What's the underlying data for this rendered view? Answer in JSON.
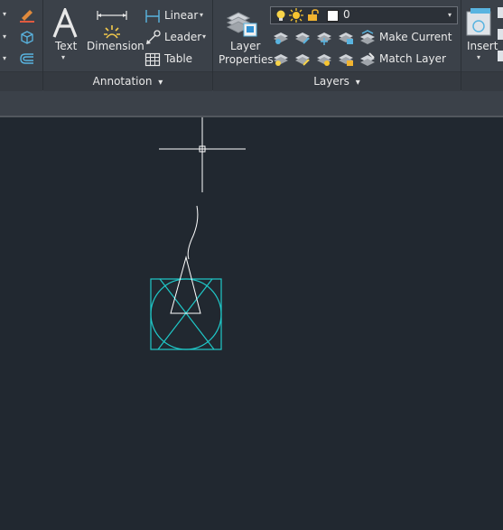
{
  "ribbon": {
    "annotation": {
      "text_label": "Text",
      "dimension_label": "Dimension",
      "linear_label": "Linear",
      "leader_label": "Leader",
      "table_label": "Table",
      "panel_title": "Annotation",
      "dropdown_arrow": "▾"
    },
    "layers": {
      "layer_properties_line1": "Layer",
      "layer_properties_line2": "Properties",
      "current_layer": "0",
      "make_current_label": "Make Current",
      "match_layer_label": "Match Layer",
      "panel_title": "Layers",
      "dropdown_arrow": "▾"
    },
    "insert": {
      "insert_label": "Insert"
    }
  },
  "colors": {
    "canvas": "#212830",
    "ribbon": "#3b4149",
    "geometry": "#1fc8c8",
    "crosshair": "#ffffff"
  }
}
